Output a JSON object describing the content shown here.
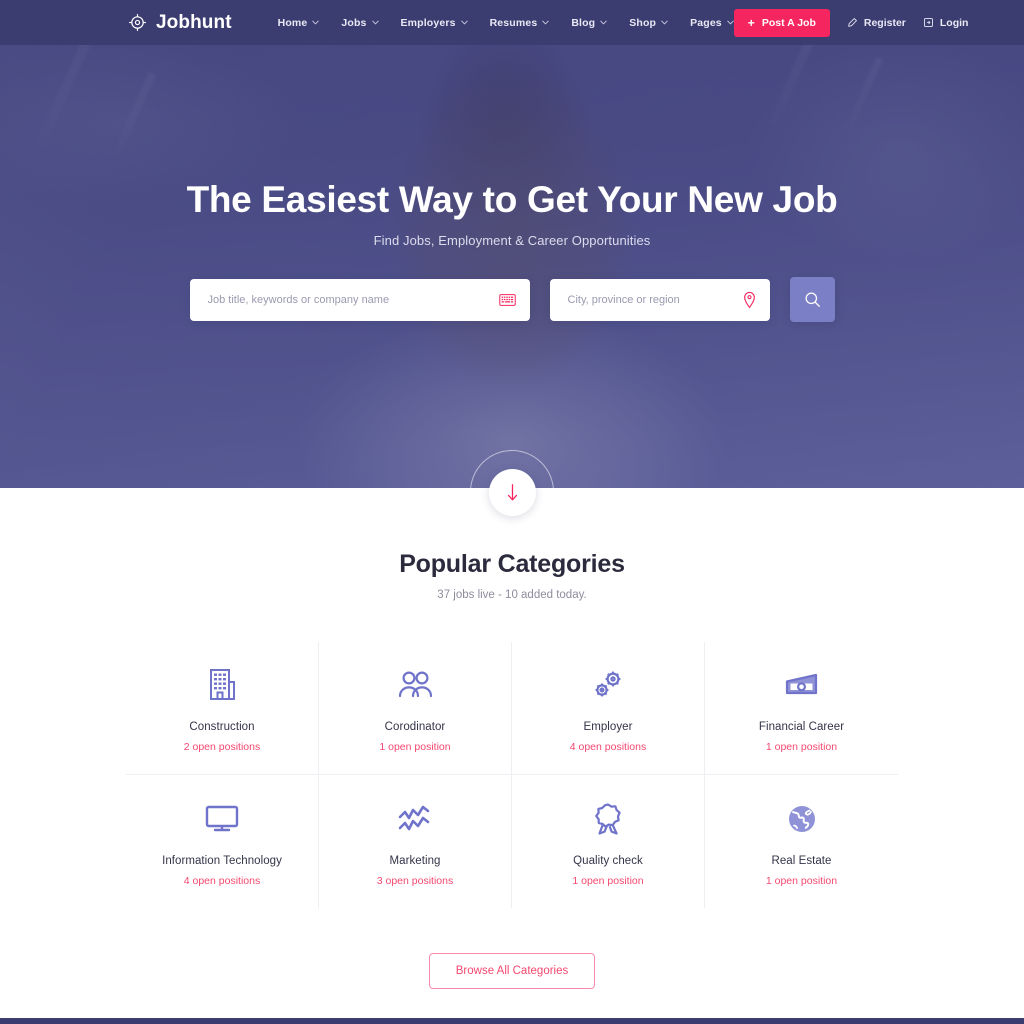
{
  "brand": {
    "name": "Jobhunt",
    "logo_icon": "crosshair-target-icon"
  },
  "nav": {
    "links": [
      {
        "label": "Home",
        "has_dropdown": true
      },
      {
        "label": "Jobs",
        "has_dropdown": true
      },
      {
        "label": "Employers",
        "has_dropdown": true
      },
      {
        "label": "Resumes",
        "has_dropdown": true
      },
      {
        "label": "Blog",
        "has_dropdown": true
      },
      {
        "label": "Shop",
        "has_dropdown": true
      },
      {
        "label": "Pages",
        "has_dropdown": true
      }
    ],
    "post_job_label": "Post A Job",
    "post_job_icon": "plus-icon",
    "register_label": "Register",
    "register_icon": "pencil-icon",
    "login_label": "Login",
    "login_icon": "login-card-icon"
  },
  "hero": {
    "title": "The Easiest Way to Get Your New Job",
    "subtitle": "Find Jobs, Employment & Career Opportunities",
    "keyword_placeholder": "Job title, keywords or company name",
    "keyword_value": "",
    "keyword_icon": "keyboard-icon",
    "location_placeholder": "City, province or region",
    "location_value": "",
    "location_icon": "map-pin-icon",
    "search_button_icon": "search-icon",
    "scroll_down_icon": "arrow-down-icon"
  },
  "categories": {
    "title": "Popular Categories",
    "subtitle": "37 jobs live - 10 added today.",
    "items": [
      {
        "name": "Construction",
        "count": "2 open positions",
        "icon": "building-icon"
      },
      {
        "name": "Corodinator",
        "count": "1 open position",
        "icon": "users-icon"
      },
      {
        "name": "Employer",
        "count": "4 open positions",
        "icon": "gears-icon"
      },
      {
        "name": "Financial Career",
        "count": "1 open position",
        "icon": "money-icon"
      },
      {
        "name": "Information Technology",
        "count": "4 open positions",
        "icon": "monitor-icon"
      },
      {
        "name": "Marketing",
        "count": "3 open positions",
        "icon": "chart-zigzag-icon"
      },
      {
        "name": "Quality check",
        "count": "1 open position",
        "icon": "award-ribbon-icon"
      },
      {
        "name": "Real Estate",
        "count": "1 open position",
        "icon": "globe-icon"
      }
    ],
    "browse_label": "Browse All Categories"
  },
  "colors": {
    "navbar": "#3b3c70",
    "accent_pink": "#f5265f",
    "count_pink": "#f5486f",
    "icon_purple": "#6f73c9",
    "search_button": "#7b7fc6"
  }
}
